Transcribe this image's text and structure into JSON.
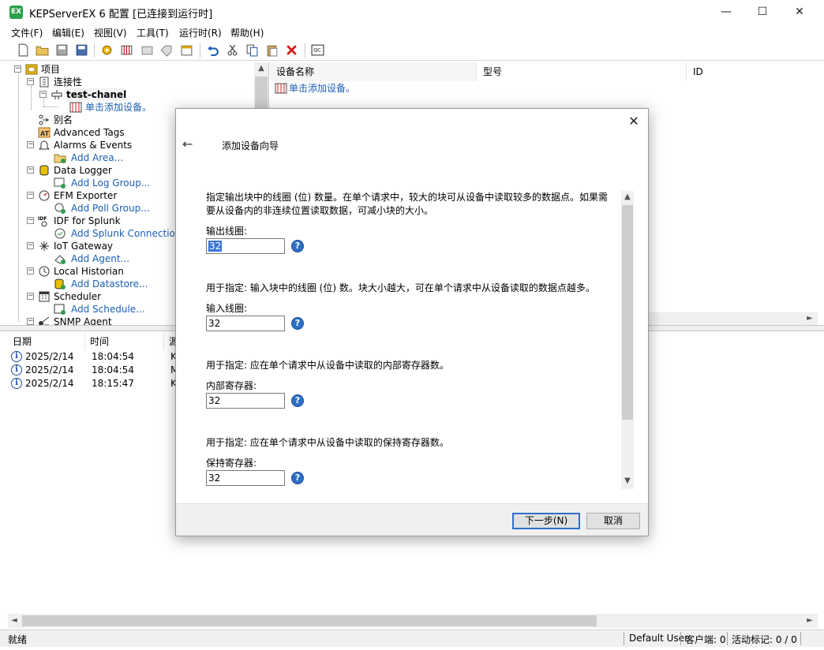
{
  "window": {
    "app_icon": "EX",
    "title": "KEPServerEX 6 配置 [已连接到运行时]",
    "minimize": "—",
    "maximize": "☐",
    "close": "✕"
  },
  "menu": [
    "文件(F)",
    "编辑(E)",
    "视图(V)",
    "工具(T)",
    "运行时(R)",
    "帮助(H)"
  ],
  "tree": {
    "root": "项目",
    "connectivity": "连接性",
    "channel": "test-chanel",
    "add_device": "单击添加设备。",
    "alias": "别名",
    "advanced_tags": "Advanced Tags",
    "alarms_events": "Alarms & Events",
    "add_area": "Add Area...",
    "data_logger": "Data Logger",
    "add_log_group": "Add Log Group...",
    "efm_exporter": "EFM Exporter",
    "add_poll_group": "Add Poll Group...",
    "idf_splunk": "IDF for Splunk",
    "add_splunk": "Add Splunk Connection...",
    "iot_gateway": "IoT Gateway",
    "add_agent": "Add Agent...",
    "local_historian": "Local Historian",
    "add_datastore": "Add Datastore...",
    "scheduler": "Scheduler",
    "add_schedule": "Add Schedule...",
    "snmp_agent": "SNMP Agent"
  },
  "detail": {
    "columns": [
      "设备名称",
      "型号",
      "ID"
    ],
    "add_device": "单击添加设备。"
  },
  "log": {
    "columns": [
      "日期",
      "时间",
      "源"
    ],
    "rows": [
      {
        "date": "2025/2/14",
        "time": "18:04:54",
        "source": "K"
      },
      {
        "date": "2025/2/14",
        "time": "18:04:54",
        "source": "M"
      },
      {
        "date": "2025/2/14",
        "time": "18:15:47",
        "source": "K"
      }
    ]
  },
  "status": {
    "ready": "就绪",
    "user": "Default User",
    "clients": "客户端: 0",
    "active_tags": "活动标记: 0 / 0"
  },
  "dialog": {
    "title": "添加设备向导",
    "back": "←",
    "close": "✕",
    "fields": [
      {
        "desc": "指定输出块中的线圈 (位) 数量。在单个请求中，较大的块可从设备中读取较多的数据点。如果需要从设备内的非连续位置读取数据，可减小块的大小。",
        "label": "输出线圈:",
        "value": "32"
      },
      {
        "desc": "用于指定: 输入块中的线圈 (位) 数。块大小越大，可在单个请求中从设备读取的数据点越多。",
        "label": "输入线圈:",
        "value": "32"
      },
      {
        "desc": "用于指定: 应在单个请求中从设备中读取的内部寄存器数。",
        "label": "内部寄存器:",
        "value": "32"
      },
      {
        "desc": "用于指定: 应在单个请求中从设备中读取的保持寄存器数。",
        "label": "保持寄存器:",
        "value": "32"
      }
    ],
    "help_glyph": "?",
    "next": "下一步(N)",
    "cancel": "取消"
  }
}
